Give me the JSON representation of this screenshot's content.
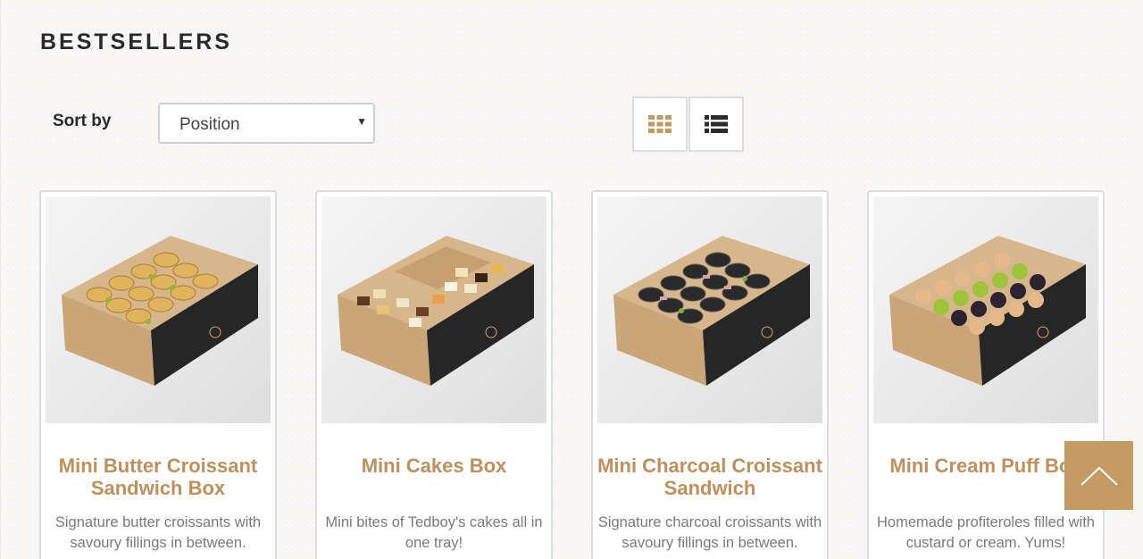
{
  "page": {
    "title": "BESTSELLERS"
  },
  "toolbar": {
    "sort_label": "Sort by",
    "sort_value": "Position",
    "grid_view_icon": "grid-view-icon",
    "list_view_icon": "list-view-icon",
    "active_view": "grid"
  },
  "colors": {
    "accent": "#bf9059",
    "scroll_top_bg": "#c59a62",
    "text_muted": "#7a7a7a"
  },
  "products": [
    {
      "name": "Mini Butter Croissant Sandwich Box",
      "description": "Signature butter croissants with savoury fillings in between."
    },
    {
      "name": "Mini Cakes Box",
      "description": "Mini bites of Tedboy's cakes all in one tray!"
    },
    {
      "name": "Mini Charcoal Croissant Sandwich",
      "description": "Signature charcoal croissants with savoury fillings in between."
    },
    {
      "name": "Mini Cream Puff Box",
      "description": "Homemade profiteroles filled with custard or cream. Yums!"
    }
  ],
  "scroll_top_icon": "chevron-up-icon"
}
